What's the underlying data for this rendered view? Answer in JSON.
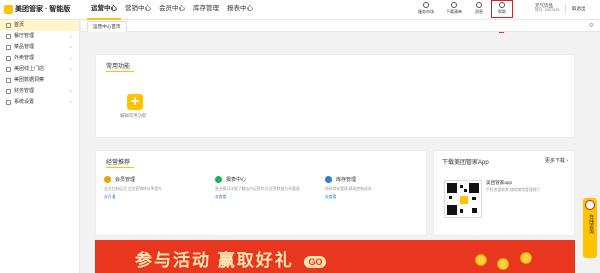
{
  "app": {
    "title": "美团管家 · 智能版"
  },
  "nav": {
    "items": [
      "运营中心",
      "营销中心",
      "会员中心",
      "库存管理",
      "报表中心"
    ],
    "active": "运营中心"
  },
  "toolbar": {
    "tools": [
      {
        "label": "服务市场",
        "icon": "store-icon"
      },
      {
        "label": "下载清单",
        "icon": "download-icon"
      },
      {
        "label": "消息",
        "icon": "bell-icon"
      },
      {
        "label": "帮助",
        "icon": "help-icon"
      }
    ],
    "annotation": "1"
  },
  "user": {
    "name": "元气饮品",
    "account": "账号: 5397635"
  },
  "logout": "取退出",
  "sidebar": {
    "items": [
      {
        "label": "首页",
        "active": true,
        "chevron": false
      },
      {
        "label": "餐厅管理",
        "chevron": true
      },
      {
        "label": "菜品管理",
        "chevron": true
      },
      {
        "label": "外卖管理",
        "chevron": true
      },
      {
        "label": "美团线上门店",
        "chevron": true
      },
      {
        "label": "美团数据洞察",
        "chevron": false
      },
      {
        "label": "财务管理",
        "chevron": true
      },
      {
        "label": "系统设置",
        "chevron": true
      }
    ]
  },
  "tabbar": {
    "tab": "运营中心首页",
    "gear": "⚙"
  },
  "common": {
    "title": "常用功能",
    "add_label": "编辑常用功能"
  },
  "recommend": {
    "title": "经营推荐",
    "items": [
      {
        "title": "会员管理",
        "desc": "会员拉新促活,会员营销转化率提升",
        "link": "去开通",
        "color": "#f0a000"
      },
      {
        "title": "报表中心",
        "desc": "营业概况详细了解店内运营状况,经营数据分析整理",
        "link": "去查看",
        "color": "#19b35a"
      },
      {
        "title": "库存管理",
        "desc": "原料库存管理,精准控制成本",
        "link": "去查看",
        "color": "#2b7cd3"
      }
    ]
  },
  "download": {
    "title": "下载美团管家App",
    "more": "更多下载",
    "app_name": "美团管家app",
    "app_desc": "手机收银收款,随时随地管理餐厅"
  },
  "banner": {
    "text": "参与活动 赢取好礼",
    "go": "GO"
  },
  "float_help": {
    "text": "在线咨询"
  },
  "colors": {
    "accent": "#ffc300",
    "banner": "#e8361f",
    "highlight": "#e02020",
    "link": "#2b7cd3"
  }
}
